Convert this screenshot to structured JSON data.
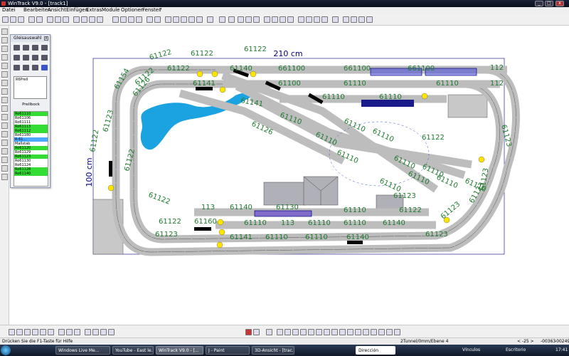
{
  "window": {
    "title": "WinTrack  V9.0 - [track1]",
    "minimize_label": "_",
    "maximize_label": "□",
    "close_label": "x"
  },
  "menu": [
    "Datei",
    "Bearbeiten",
    "Ansicht",
    "Einfügen",
    "Extras",
    "Module",
    "Optionen",
    "Fenster",
    "?"
  ],
  "palette": {
    "title": "Gleisauswahl",
    "close_label": "x",
    "preview_code": "R6Prell",
    "selected_name": "Prellbock",
    "items": [
      {
        "label": "Ro61110",
        "state": "green"
      },
      {
        "label": "Ro61106",
        "state": "none"
      },
      {
        "label": "Ro61111",
        "state": "none"
      },
      {
        "label": "Ro61113",
        "state": "green"
      },
      {
        "label": "Ro61112",
        "state": "green"
      },
      {
        "label": "Ro61180",
        "state": "none"
      },
      {
        "label": "R-61...",
        "state": "blue"
      },
      {
        "label": "Maßstab",
        "state": "none"
      },
      {
        "label": "Ro61120",
        "state": "green"
      },
      {
        "label": "Ro61129",
        "state": "none"
      },
      {
        "label": "Ro61123",
        "state": "green"
      },
      {
        "label": "Ro61130",
        "state": "none"
      },
      {
        "label": "Ro61124",
        "state": "none"
      },
      {
        "label": "Ro61128",
        "state": "green"
      },
      {
        "label": "Ro61140",
        "state": "green"
      }
    ]
  },
  "layout": {
    "width_label": "210 cm",
    "height_label": "100 cm",
    "track_labels": [
      "61122",
      "61122",
      "61122",
      "61140",
      "661100",
      "661100",
      "661100",
      "112",
      "61100",
      "61141",
      "61110",
      "61110",
      "61110",
      "61110",
      "112",
      "61154",
      "61122",
      "61122",
      "61126",
      "61141",
      "61110",
      "61110",
      "61110",
      "61110",
      "61122",
      "61123",
      "61126",
      "61110",
      "61110",
      "61110",
      "61122",
      "61123",
      "61110",
      "61110",
      "61110",
      "61110",
      "61123",
      "61122",
      "113",
      "61140",
      "61130",
      "61110",
      "61122",
      "61122",
      "61160",
      "61110",
      "113",
      "61110",
      "61110",
      "61140",
      "61123",
      "61123",
      "61141",
      "61110",
      "61110",
      "61140",
      "61123",
      "61122",
      "61123",
      "61123"
    ],
    "colors": {
      "track": "#c8c8c8",
      "label": "#1e7a2e",
      "water": "#1aa3e0",
      "frame": "#000080",
      "building": "#b0b0b8"
    }
  },
  "status": {
    "hint": "Drücken Sie die  F1-Taste für Hilfe",
    "tunnel_info": "2Tunnel/0mm/Ebene 4",
    "zoom": "< -25 >",
    "coord_x": "-00363",
    "coord_y": "-00249"
  },
  "taskbar": {
    "tasks": [
      "Windows Live Me...",
      "YouTube - East le...",
      "WinTrack  V9.0 - [...",
      "J - Paint",
      "3D-Ansicht - [trac...",
      "Dirección"
    ],
    "tray_items": [
      "Vínculos",
      "Escritorio"
    ],
    "clock": "17:41"
  }
}
